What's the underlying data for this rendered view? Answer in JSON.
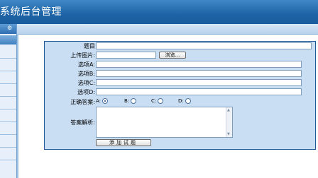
{
  "header": {
    "title": "系统后台管理"
  },
  "sidebar": {
    "gear_icon": "gear-icon"
  },
  "form": {
    "rows": {
      "question_label": "题目",
      "upload_label": "上传图片:",
      "browse_label": "浏览...",
      "option_a_label": "选项A:",
      "option_b_label": "选项B:",
      "option_c_label": "选项C:",
      "option_d_label": "选项D:",
      "answer_label": "正确答案:",
      "explanation_label": "答案解析:"
    },
    "answers": [
      {
        "label": "A:",
        "checked": true
      },
      {
        "label": "B:",
        "checked": false
      },
      {
        "label": "C:",
        "checked": false
      },
      {
        "label": "D:",
        "checked": false
      }
    ],
    "submit_label": "添加试题"
  },
  "colors": {
    "header_blue": "#1d63a6",
    "panel_bg": "#c9def3",
    "panel_border": "#1e5a96"
  }
}
